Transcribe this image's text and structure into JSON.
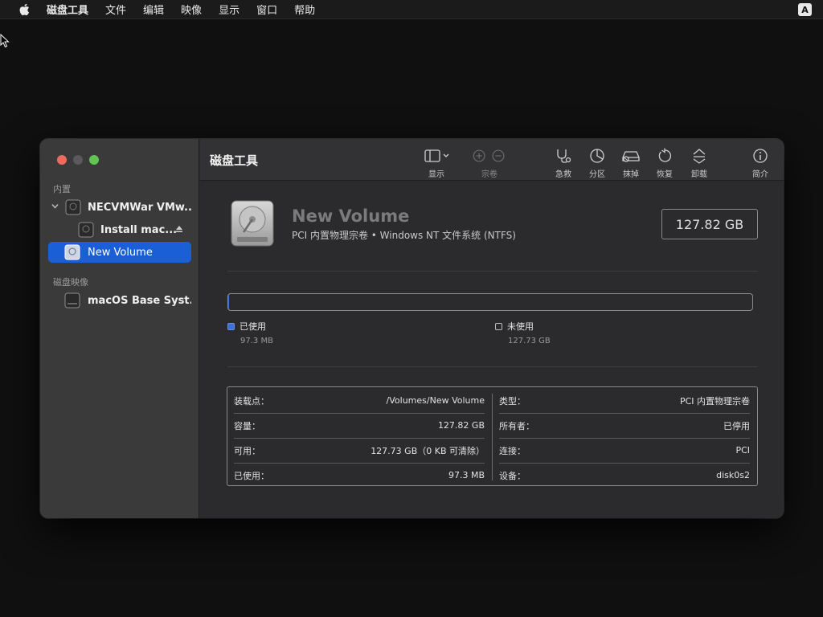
{
  "menubar": {
    "app_name": "磁盘工具",
    "items": [
      "文件",
      "编辑",
      "映像",
      "显示",
      "窗口",
      "帮助"
    ],
    "input_source": "A"
  },
  "window": {
    "title": "磁盘工具",
    "sidebar": {
      "section_internal": "内置",
      "section_images": "磁盘映像",
      "items": [
        {
          "label": "NECVMWar VMw..."
        },
        {
          "label": "Install mac..."
        },
        {
          "label": "New Volume"
        },
        {
          "label": "macOS Base Syst..."
        }
      ]
    },
    "toolbar": {
      "view": "显示",
      "volume": "宗卷",
      "first_aid": "急救",
      "partition": "分区",
      "erase": "抹掉",
      "restore": "恢复",
      "unmount": "卸载",
      "info": "简介"
    },
    "volume": {
      "name": "New Volume",
      "subtitle": "PCI 内置物理宗卷 • Windows NT 文件系统 (NTFS)",
      "capacity": "127.82 GB",
      "used_fraction": 0.0008
    },
    "usage": {
      "used_label": "已使用",
      "used_value": "97.3 MB",
      "free_label": "未使用",
      "free_value": "127.73 GB"
    },
    "info": {
      "left": [
        {
          "key": "装载点：",
          "value": "/Volumes/New Volume"
        },
        {
          "key": "容量：",
          "value": "127.82 GB"
        },
        {
          "key": "可用：",
          "value": "127.73 GB（0 KB 可清除）"
        },
        {
          "key": "已使用：",
          "value": "97.3 MB"
        }
      ],
      "right": [
        {
          "key": "类型：",
          "value": "PCI 内置物理宗卷"
        },
        {
          "key": "所有者：",
          "value": "已停用"
        },
        {
          "key": "连接：",
          "value": "PCI"
        },
        {
          "key": "设备：",
          "value": "disk0s2"
        }
      ]
    }
  },
  "colors": {
    "selection": "#1b5fd6",
    "used_swatch": "#3d6fd6",
    "close": "#ed6a5e",
    "zoom": "#61c454"
  }
}
